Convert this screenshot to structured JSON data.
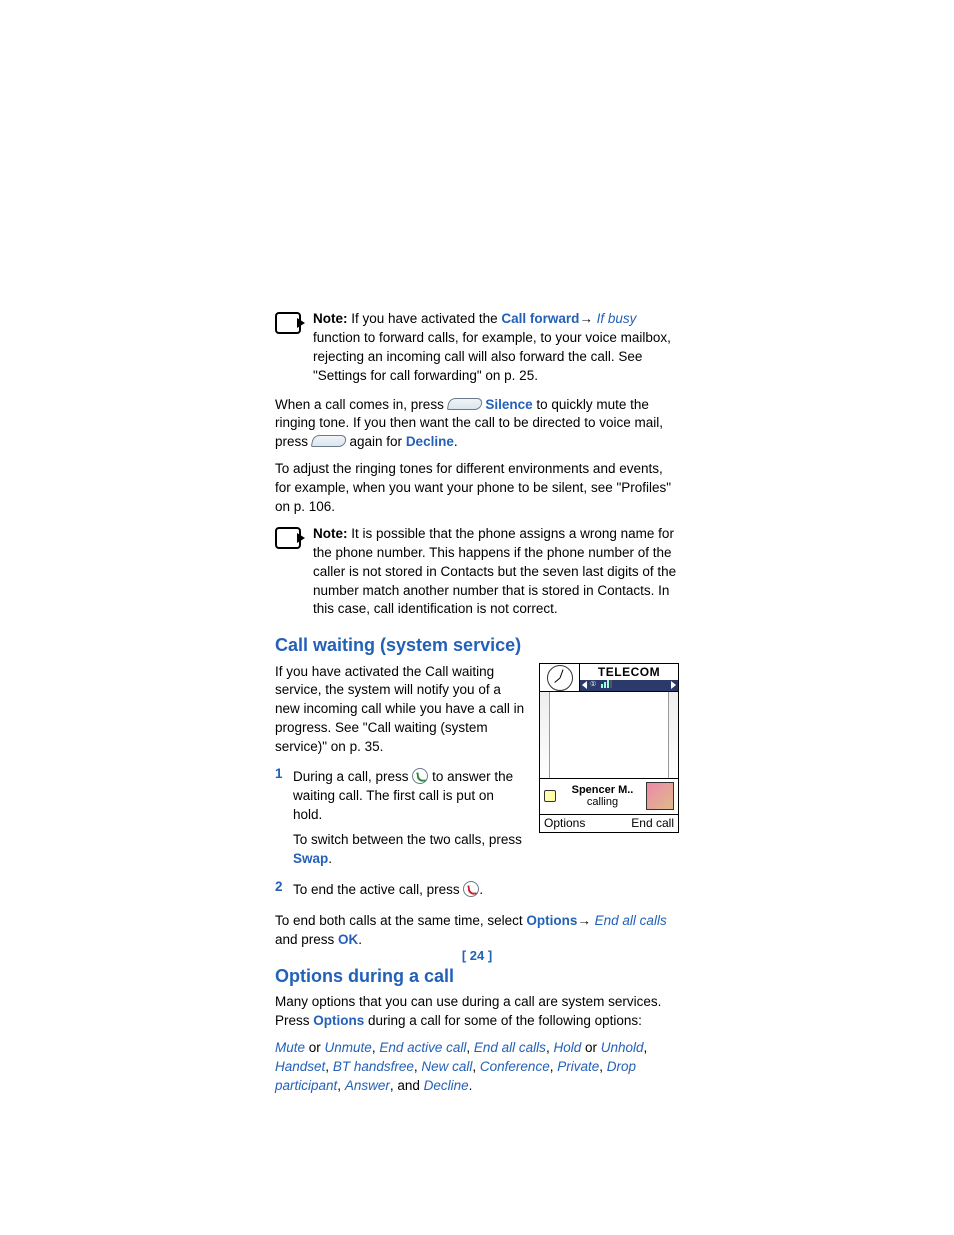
{
  "note1": {
    "label": "Note:",
    "t1": " If you have activated the ",
    "link1": "Call forward",
    "arrow": "→ ",
    "link2": "If busy",
    "t2": " function to forward calls, for example, to your voice mailbox, rejecting an incoming call will also forward the call. See \"Settings for call forwarding\" on p. 25."
  },
  "para1": {
    "t1": "When a call comes in, press ",
    "link1": "Silence",
    "t2": " to quickly mute the ringing tone. If you then want the call to be directed to voice mail, press ",
    "t3": " again for ",
    "link2": "Decline",
    "t4": "."
  },
  "para2": "To adjust the ringing tones for different environments and events, for example, when you want your phone to be silent, see \"Profiles\" on p. 106.",
  "note2": {
    "label": "Note:",
    "text": " It is possible that the phone assigns a wrong name for the phone number. This happens if the phone number of the caller is not stored in Contacts but the seven last digits of the number match another number that is stored in Contacts. In this case, call identification is not correct."
  },
  "heading1": "Call waiting (system service)",
  "cw_intro": "If you have activated the Call waiting service, the system will notify you of a new incoming call while you have a call in progress. See \"Call waiting (system service)\" on p. 35.",
  "step1": {
    "num": "1",
    "t1": "During a call, press ",
    "t2": " to answer the waiting call. The first call is put on hold.",
    "t3": "To switch between the two calls, press ",
    "link": "Swap",
    "t4": "."
  },
  "step2": {
    "num": "2",
    "t1": "To end the active call, press ",
    "t2": "."
  },
  "cw_end": {
    "t1": "To end both calls at the same time, select ",
    "link1": "Options",
    "arrow": "→ ",
    "link2": "End all calls",
    "t2": " and press ",
    "link3": "OK",
    "t3": "."
  },
  "heading2": "Options during a call",
  "opt_intro": {
    "t1": "Many options that you can use during a call are system services. Press ",
    "link": "Options",
    "t2": " during a call for some of the following options:"
  },
  "opt_list": {
    "i1": "Mute",
    "c1": " or ",
    "i2": "Unmute",
    "c2": ", ",
    "i3": "End active call",
    "c3": ", ",
    "i4": "End all calls",
    "c4": ", ",
    "i5": "Hold",
    "c5": " or ",
    "i6": "Unhold",
    "c6": ", ",
    "i7": "Handset",
    "c7": ", ",
    "i8": "BT handsfree",
    "c8": ", ",
    "i9": "New call",
    "c9": ", ",
    "i10": "Conference",
    "c10": ", ",
    "i11": "Private",
    "c11": ", ",
    "i12": "Drop participant",
    "c12": ", ",
    "i13": "Answer",
    "c13": ", and ",
    "i14": "Decline",
    "c14": "."
  },
  "phone": {
    "title": "TELECOM",
    "caller_name": "Spencer M..",
    "caller_status": "calling",
    "soft_left": "Options",
    "soft_right": "End call"
  },
  "pagenum": "[ 24 ]"
}
